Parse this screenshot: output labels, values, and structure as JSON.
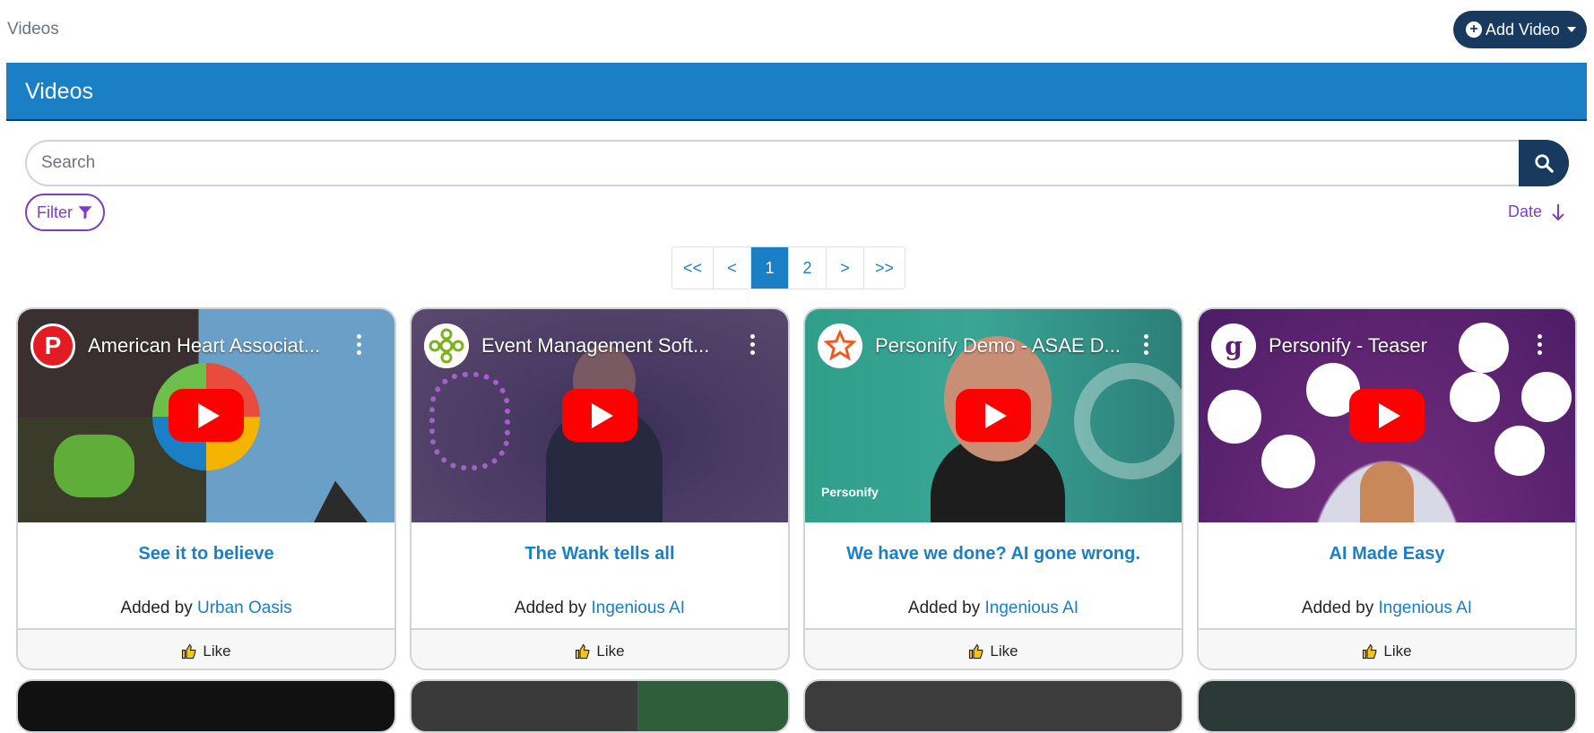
{
  "breadcrumb": "Videos",
  "add_video_label": "Add Video",
  "panel_title": "Videos",
  "search": {
    "placeholder": "Search"
  },
  "filter_label": "Filter",
  "sort_label": "Date",
  "pagination": [
    "<<",
    "<",
    "1",
    "2",
    ">",
    ">>"
  ],
  "pagination_active": "1",
  "cards": [
    {
      "video_title": "American Heart Associat...",
      "channel_letter": "P",
      "title": "See it to believe",
      "added_by_prefix": "Added by",
      "added_by": "Urban Oasis",
      "like": "Like"
    },
    {
      "video_title": "Event Management Soft...",
      "channel_letter": "",
      "title": "The Wank tells all",
      "added_by_prefix": "Added by",
      "added_by": "Ingenious AI",
      "like": "Like"
    },
    {
      "video_title": "Personify Demo - ASAE D...",
      "channel_letter": "",
      "title": "We have we done? AI gone wrong.",
      "added_by_prefix": "Added by",
      "added_by": "Ingenious AI",
      "like": "Like"
    },
    {
      "video_title": "Personify - Teaser",
      "channel_letter": "g",
      "title": "AI Made Easy",
      "added_by_prefix": "Added by",
      "added_by": "Ingenious AI",
      "like": "Like"
    }
  ],
  "thumb_overlay_text": {
    "personify_watermark": "Personify"
  },
  "colors": {
    "primary": "#1a7fc4",
    "navy": "#173a5e",
    "purple": "#7b3fbf",
    "youtube_red": "#ff0000"
  }
}
